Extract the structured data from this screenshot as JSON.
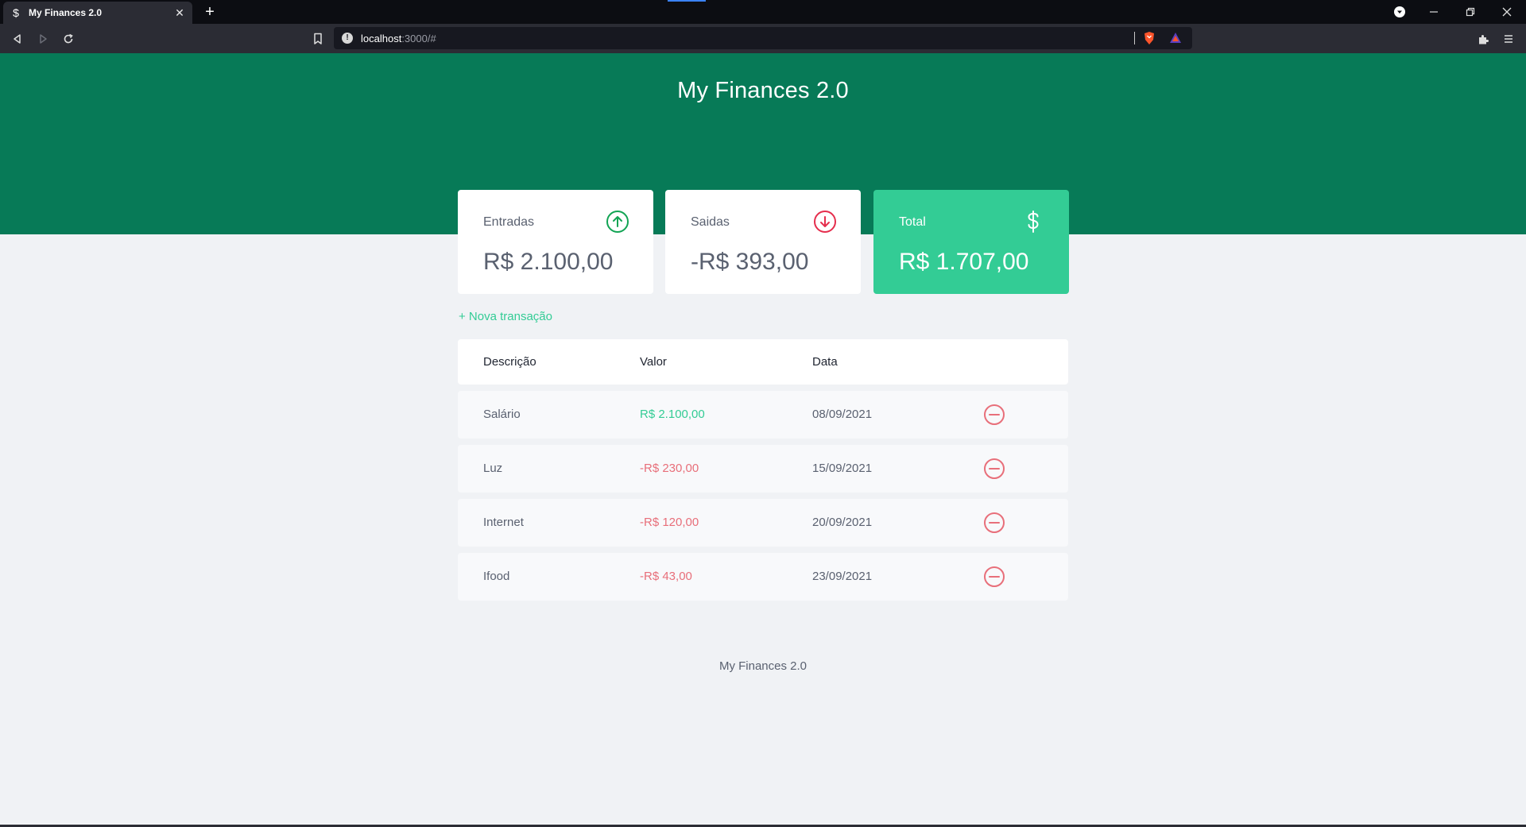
{
  "browser": {
    "tab_title": "My Finances 2.0",
    "tab_favicon": "$",
    "tab_close": "✕",
    "new_tab": "+",
    "url_host": "localhost",
    "url_path": ":3000/#",
    "brand_icon": "brave-shield-icon"
  },
  "app": {
    "title": "My Finances 2.0",
    "footer": "My Finances 2.0",
    "colors": {
      "header": "#077a57",
      "accent": "#33cc95",
      "expense": "#e86f7a",
      "background": "#f0f2f5"
    }
  },
  "summary": {
    "income": {
      "label": "Entradas",
      "value": "R$ 2.100,00",
      "icon": "arrow-up-circle-icon"
    },
    "expense": {
      "label": "Saidas",
      "value": "-R$ 393,00",
      "icon": "arrow-down-circle-icon"
    },
    "total": {
      "label": "Total",
      "value": "R$ 1.707,00",
      "icon": "dollar-icon"
    }
  },
  "actions": {
    "new_transaction": "+ Nova transação"
  },
  "table": {
    "headers": [
      "Descrição",
      "Valor",
      "Data"
    ],
    "rows": [
      {
        "description": "Salário",
        "amount": "R$ 2.100,00",
        "type": "income",
        "date": "08/09/2021"
      },
      {
        "description": "Luz",
        "amount": "-R$ 230,00",
        "type": "expense",
        "date": "15/09/2021"
      },
      {
        "description": "Internet",
        "amount": "-R$ 120,00",
        "type": "expense",
        "date": "20/09/2021"
      },
      {
        "description": "Ifood",
        "amount": "-R$ 43,00",
        "type": "expense",
        "date": "23/09/2021"
      }
    ]
  }
}
